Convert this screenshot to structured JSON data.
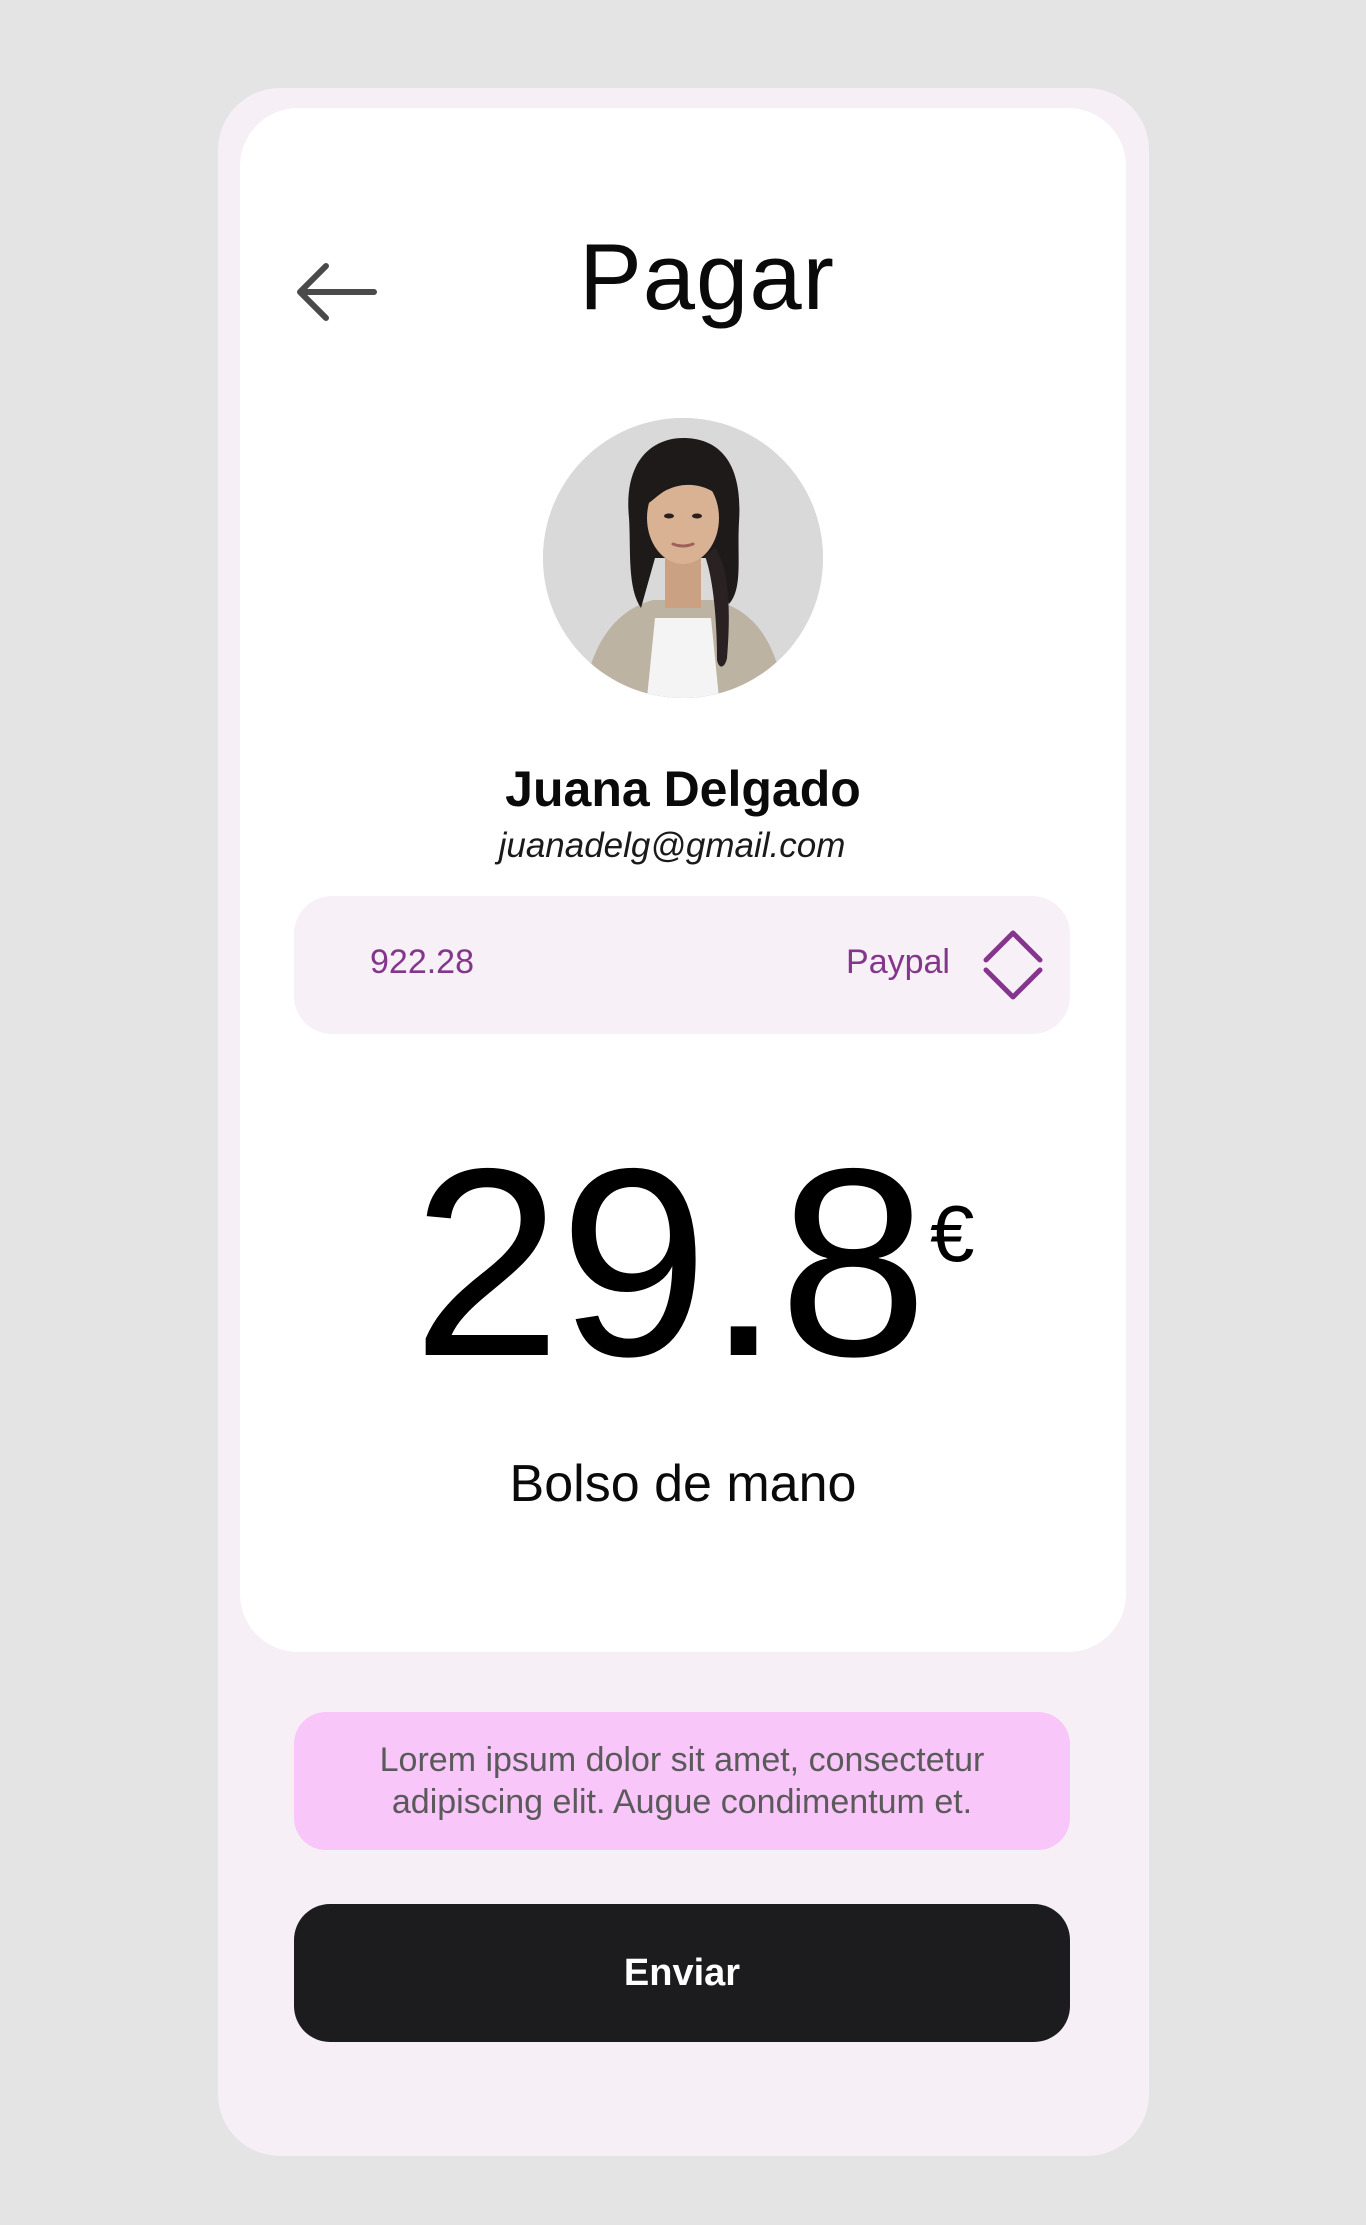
{
  "header": {
    "title": "Pagar",
    "back_icon": "arrow-left-icon"
  },
  "user": {
    "name": "Juana Delgado",
    "email": "juanadelg@gmail.com",
    "avatar": "profile-photo"
  },
  "payment": {
    "balance": "922.28",
    "method": "Paypal",
    "selector_icon": "chevron-up-down-icon"
  },
  "transaction": {
    "amount": "29.8",
    "currency": "€",
    "product": "Bolso de mano"
  },
  "notice": {
    "text": "Lorem ipsum dolor sit amet, consectetur adipiscing elit. Augue condimentum et."
  },
  "actions": {
    "send_label": "Enviar"
  },
  "colors": {
    "background": "#e4e4e4",
    "outer_card": "#f6eff6",
    "card": "#ffffff",
    "accent_purple": "#84358c",
    "notice_bg": "#f8c6f9",
    "button_bg": "#1c1c1e"
  }
}
